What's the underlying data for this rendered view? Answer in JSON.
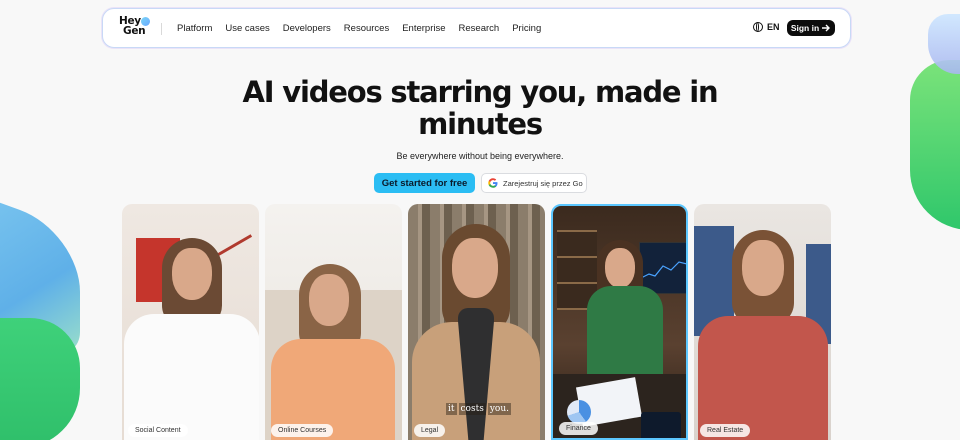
{
  "nav": {
    "logo_line1": "Hey",
    "logo_line2": "Gen",
    "items": [
      "Platform",
      "Use cases",
      "Developers",
      "Resources",
      "Enterprise",
      "Research",
      "Pricing"
    ],
    "language": "EN",
    "signin_label": "Sign in"
  },
  "hero": {
    "title_line1": "AI videos starring you, made in",
    "title_line2": "minutes",
    "subtitle": "Be everywhere without being everywhere.",
    "cta_primary": "Get started for free",
    "cta_google": "Zarejestruj się przez Go"
  },
  "cards": [
    {
      "label": "Social Content"
    },
    {
      "label": "Online Courses"
    },
    {
      "label": "Legal",
      "caption_words": [
        "it",
        "costs",
        "you."
      ]
    },
    {
      "label": "Finance"
    },
    {
      "label": "Real Estate"
    }
  ],
  "colors": {
    "accent_cta": "#2bbdf3",
    "signin_bg": "#0c0c0c",
    "finance_border": "#5cc7ff"
  }
}
